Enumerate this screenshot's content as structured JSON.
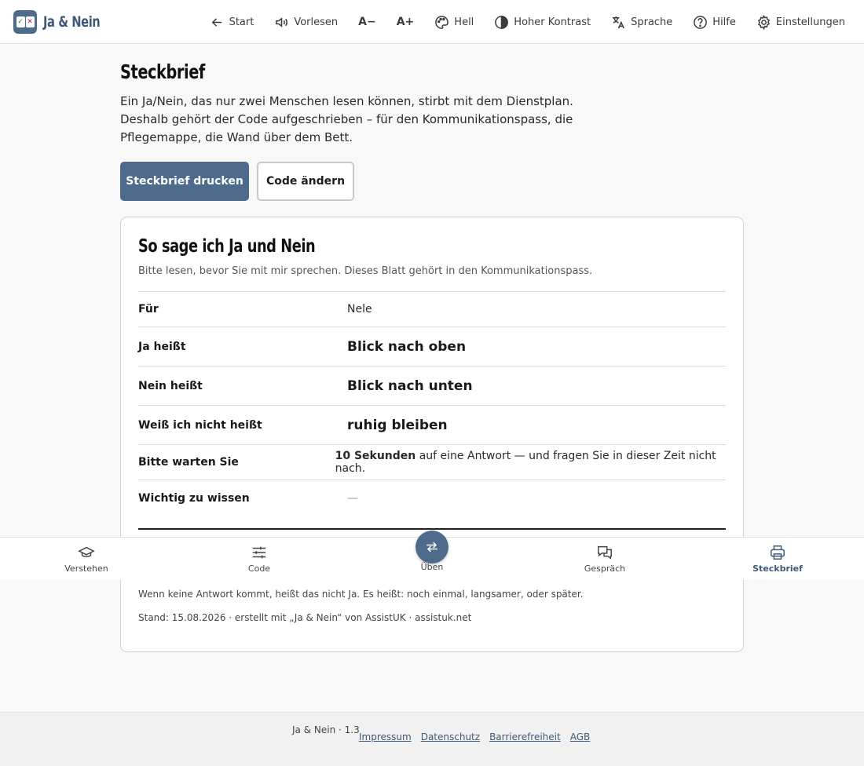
{
  "app": {
    "brand_name": "Ja & Nein",
    "logo_yes": "✓",
    "logo_no": "✕",
    "accent_color": "#4e6b8c"
  },
  "nav": {
    "start": "Start",
    "read_aloud": "Vorlesen",
    "font_smaller": "A−",
    "font_larger": "A+",
    "theme": "Hell",
    "contrast": "Hoher Kontrast",
    "language": "Sprache",
    "help": "Hilfe",
    "settings": "Einstellungen"
  },
  "page": {
    "title": "Steckbrief",
    "intro": "Ein Ja/Nein, das nur zwei Menschen lesen können, stirbt mit dem Dienstplan. Deshalb gehört der Code aufgeschrieben – für den Kommunikationspass, die Pflegemappe, die Wand über dem Bett.",
    "print_button": "Steckbrief drucken",
    "change_button": "Code ändern"
  },
  "card": {
    "title": "So sage ich Ja und Nein",
    "subtitle": "Bitte lesen, bevor Sie mit mir sprechen. Dieses Blatt gehört in den Kommunikationspass.",
    "rows": [
      {
        "label": "Für",
        "value": "Nele"
      },
      {
        "label": "Ja heißt",
        "value": "Blick nach oben"
      },
      {
        "label": "Nein heißt",
        "value": "Blick nach unten"
      },
      {
        "label": "Weiß ich nicht heißt",
        "value": "ruhig bleiben"
      },
      {
        "label": "Bitte warten Sie",
        "value_strong": "10 Sekunden",
        "value_rest": " auf eine Antwort — und fragen Sie in dieser Zeit nicht nach."
      },
      {
        "label": "Wichtig zu wissen",
        "value": "—"
      }
    ],
    "note": "Wenn keine Antwort kommt, heißt das nicht Ja. Es heißt: noch einmal, langsamer, oder später.",
    "stamp": "Stand: 15.08.2026 · erstellt mit „Ja & Nein“ von AssistUK · assistuk.net"
  },
  "tabs": {
    "understand": "Verstehen",
    "code": "Code",
    "practice": "Üben",
    "conversation": "Gespräch",
    "profile": "Steckbrief"
  },
  "footer": {
    "version": "Ja & Nein · 1.3",
    "links": [
      "Impressum",
      "Datenschutz",
      "Barrierefreiheit",
      "AGB"
    ]
  }
}
